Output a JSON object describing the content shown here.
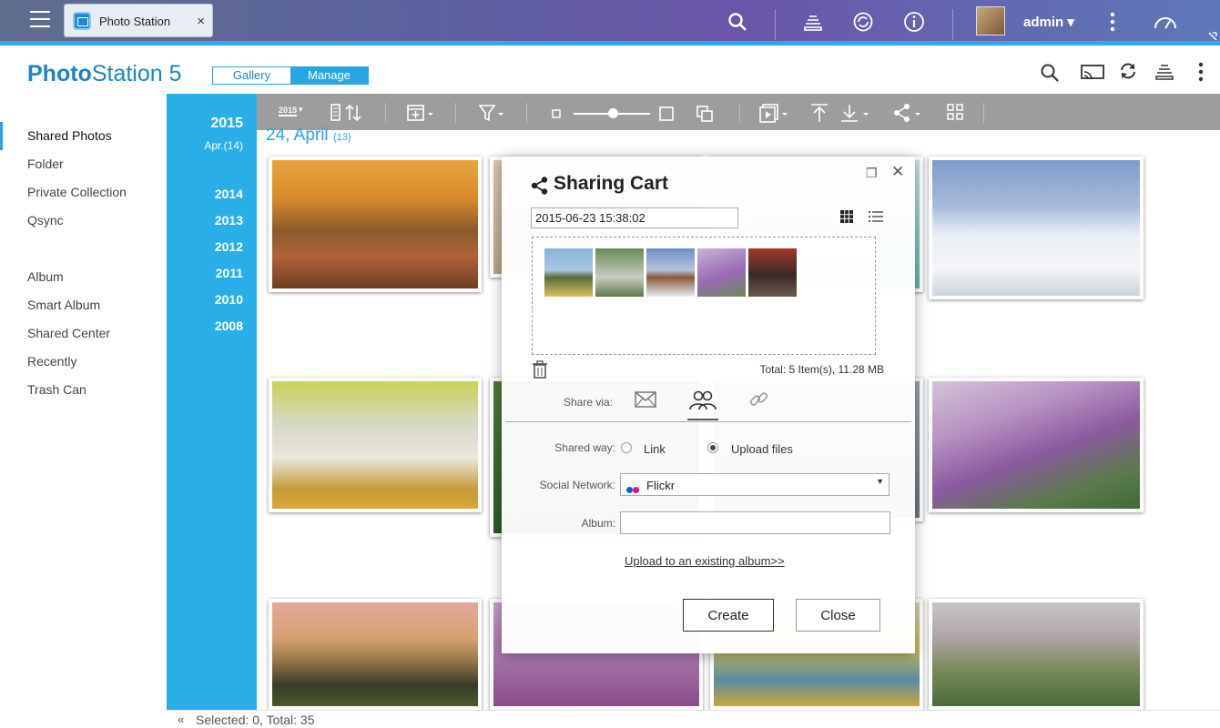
{
  "qts": {
    "app_tab_label": "Photo Station",
    "tab_close": "×",
    "username": "admin",
    "username_caret": "▾"
  },
  "header": {
    "title_prefix": "Photo",
    "title_suffix": "Station 5",
    "mode_gallery": "Gallery",
    "mode_manage": "Manage"
  },
  "sidebar": {
    "group1": [
      {
        "label": "Shared Photos",
        "active": true
      },
      {
        "label": "Folder"
      },
      {
        "label": "Private Collection"
      },
      {
        "label": "Qsync"
      }
    ],
    "group2": [
      {
        "label": "Album"
      },
      {
        "label": "Smart Album"
      },
      {
        "label": "Shared Center"
      },
      {
        "label": "Recently"
      },
      {
        "label": "Trash Can"
      }
    ]
  },
  "timeline": {
    "current_year": "2015",
    "current_month": "Apr.(14)",
    "years": [
      "2014",
      "2013",
      "2012",
      "2011",
      "2010",
      "2008"
    ]
  },
  "toolbar": {
    "year_badge": "2015"
  },
  "content": {
    "date_heading": "24, April",
    "date_count": "(13)"
  },
  "status": {
    "collapse": "«",
    "text": "Selected: 0, Total: 35"
  },
  "dialog": {
    "title": "Sharing Cart",
    "restore": "❐",
    "close": "✕",
    "cart_name": "2015-06-23 15:38:02",
    "total": "Total: 5 Item(s), 11.28 MB",
    "share_via_label": "Share via:",
    "shared_way_label": "Shared way:",
    "option_link": "Link",
    "option_upload": "Upload files",
    "selected_option": "Upload files",
    "social_network_label": "Social Network:",
    "social_network_value": "Flickr",
    "album_label": "Album:",
    "album_value": "",
    "upload_existing": "Upload to an existing album>>",
    "create": "Create",
    "close_button": "Close"
  },
  "colors": {
    "accent": "#29a3e0",
    "timeline": "#2aaee8",
    "toolbar": "#9d9d9d",
    "flickr_blue": "#0063dc",
    "flickr_pink": "#ff0084"
  }
}
